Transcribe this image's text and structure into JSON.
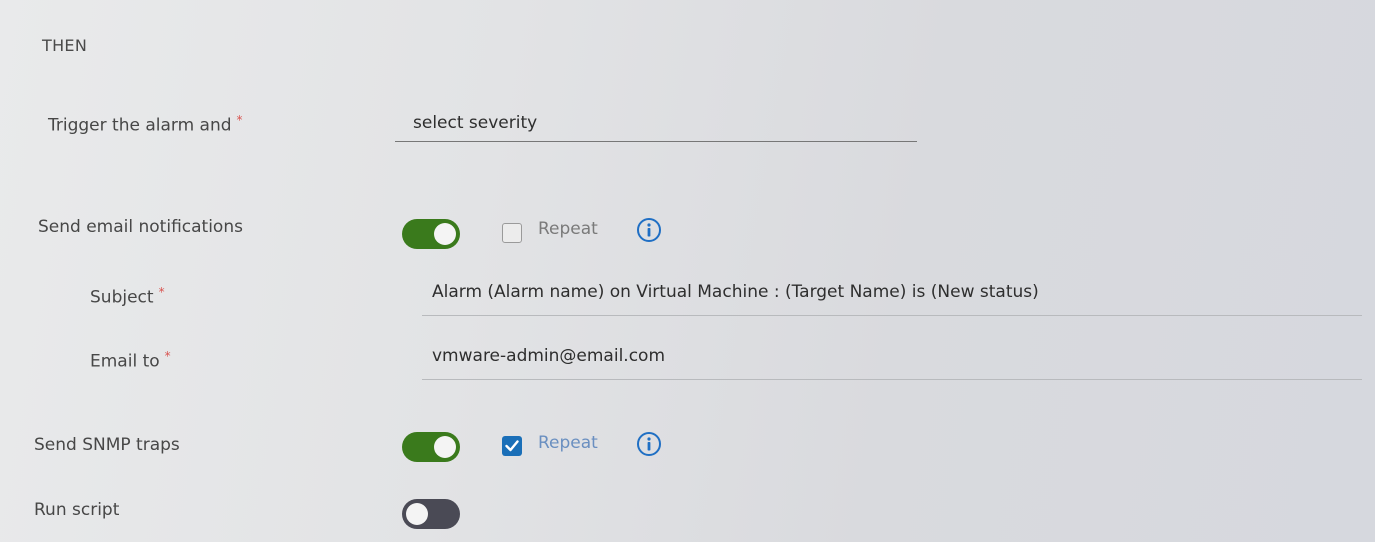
{
  "section": {
    "title": "THEN"
  },
  "trigger": {
    "label": "Trigger the alarm and",
    "required_mark": "*",
    "select_value": "select severity"
  },
  "email_notifications": {
    "label": "Send email notifications",
    "toggle_on": true,
    "repeat_label": "Repeat",
    "repeat_checked": false,
    "subject": {
      "label": "Subject",
      "required_mark": "*",
      "value": "Alarm (Alarm name) on Virtual Machine : (Target Name) is (New status)"
    },
    "email_to": {
      "label": "Email to",
      "required_mark": "*",
      "value": "vmware-admin@email.com"
    }
  },
  "snmp_traps": {
    "label": "Send SNMP traps",
    "toggle_on": true,
    "repeat_label": "Repeat",
    "repeat_checked": true
  },
  "run_script": {
    "label": "Run script",
    "toggle_on": false
  },
  "colors": {
    "toggle_on": "#3a7a1c",
    "toggle_off": "#4a4a55",
    "checkbox_checked": "#1a6fb8",
    "info_icon": "#1f6fc4",
    "required": "#d9534f"
  },
  "icons": {
    "info": "info-circle-icon"
  }
}
